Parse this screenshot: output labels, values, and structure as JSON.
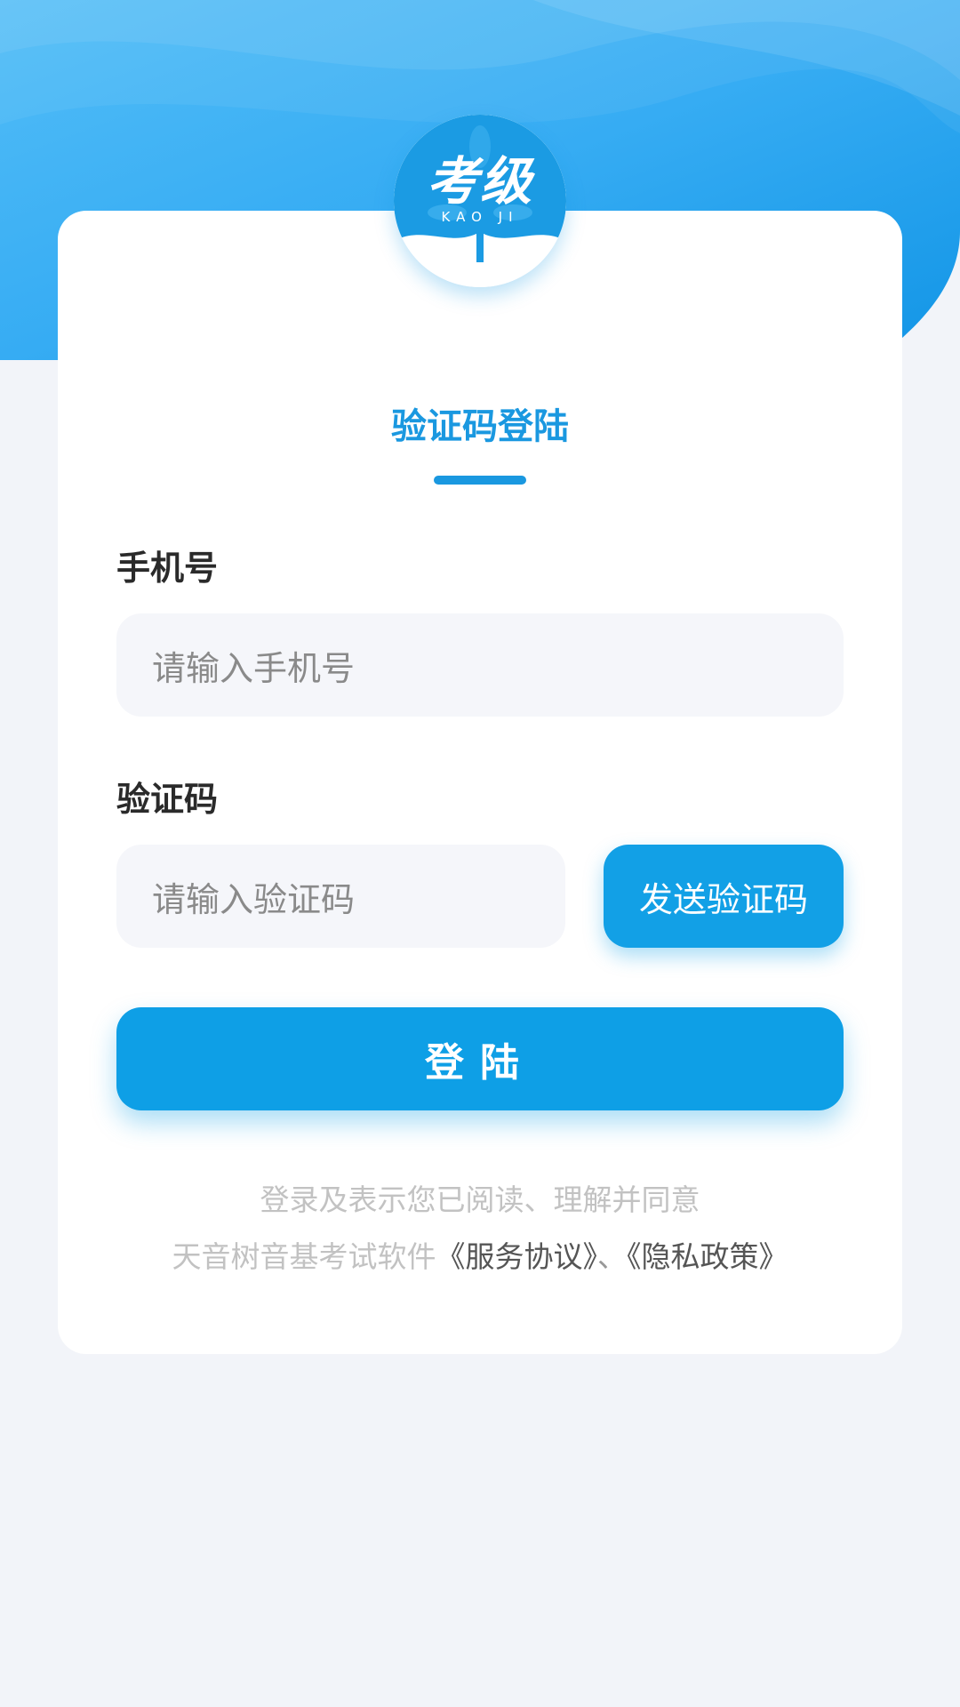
{
  "logo": {
    "title": "考级",
    "subtitle": "KAO JI"
  },
  "tab": {
    "title": "验证码登陆"
  },
  "phone": {
    "label": "手机号",
    "placeholder": "请输入手机号"
  },
  "code": {
    "label": "验证码",
    "placeholder": "请输入验证码",
    "send_button": "发送验证码"
  },
  "login_button": "登陆",
  "agreement": {
    "line1": "登录及表示您已阅读、理解并同意",
    "prefix": "天音树音基考试软件",
    "service": "《服务协议》",
    "separator": "、",
    "privacy": "《隐私政策》"
  },
  "colors": {
    "primary": "#1a98e0",
    "button": "#0e9fe6",
    "background": "#f2f4f9"
  }
}
